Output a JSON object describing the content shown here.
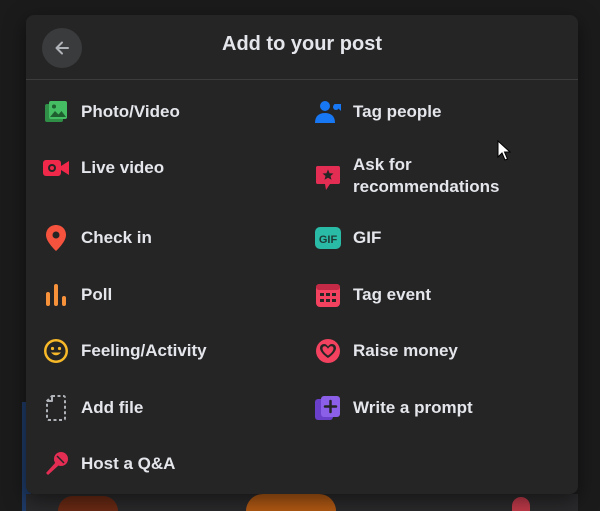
{
  "dialog": {
    "title": "Add to your post",
    "back_icon": "arrow-left-icon"
  },
  "options": {
    "left": [
      {
        "label": "Photo/Video",
        "icon": "photo-video-icon",
        "color": "#45bd62"
      },
      {
        "label": "Live video",
        "icon": "live-video-icon",
        "color": "#f02849"
      },
      {
        "label": "Check in",
        "icon": "location-pin-icon",
        "color": "#f5533d"
      },
      {
        "label": "Poll",
        "icon": "poll-icon",
        "color": "#f7923b"
      },
      {
        "label": "Feeling/Activity",
        "icon": "smiley-icon",
        "color": "#f7b928"
      },
      {
        "label": "Add file",
        "icon": "file-icon",
        "color": "#b0b3b8"
      },
      {
        "label": "Host a Q&A",
        "icon": "microphone-icon",
        "color": "#e42d53"
      }
    ],
    "right": [
      {
        "label": "Tag people",
        "icon": "tag-people-icon",
        "color": "#1877f2"
      },
      {
        "label": "Ask for recommendations",
        "icon": "recommendation-icon",
        "color": "#e42d53"
      },
      {
        "label": "GIF",
        "icon": "gif-icon",
        "color": "#2abba7"
      },
      {
        "label": "Tag event",
        "icon": "calendar-icon",
        "color": "#f3425f"
      },
      {
        "label": "Raise money",
        "icon": "fundraiser-icon",
        "color": "#f3425f"
      },
      {
        "label": "Write a prompt",
        "icon": "prompt-icon",
        "color": "#8c5fe8"
      }
    ]
  },
  "gif_badge_text": "GIF"
}
